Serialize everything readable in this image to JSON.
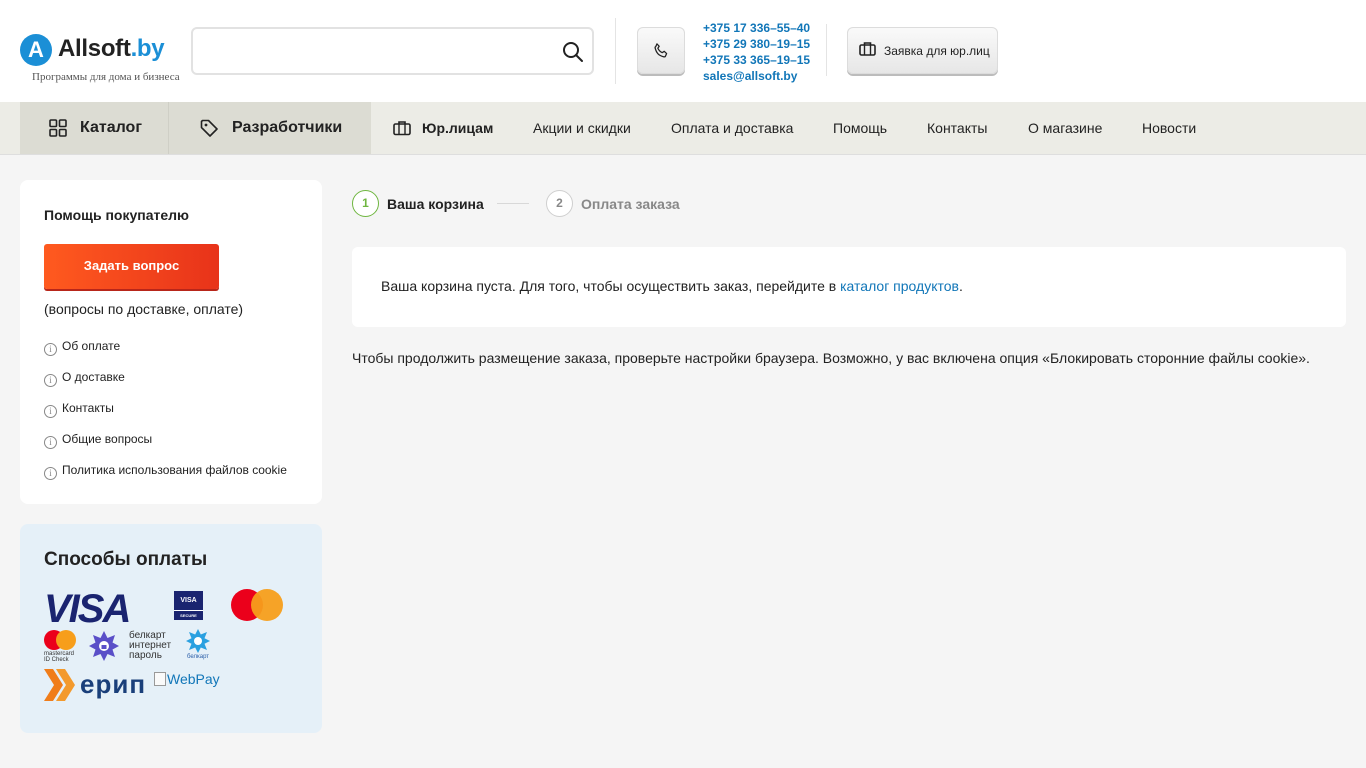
{
  "header": {
    "logo_letter": "A",
    "logo_name": "Allsoft",
    "logo_domain": ".by",
    "tagline": "Программы для дома и бизнеса",
    "search": {
      "value": "",
      "placeholder": ""
    },
    "phones": [
      "+375 17 336–55–40",
      "+375 29 380–19–15",
      "+375 33 365–19–15"
    ],
    "email": "sales@allsoft.by",
    "corp_request_label": "Заявка для юр.лиц"
  },
  "nav": {
    "catalog": "Каталог",
    "developers": "Разработчики",
    "legal": "Юр.лицам",
    "promotions": "Акции и скидки",
    "payment_delivery": "Оплата и доставка",
    "help": "Помощь",
    "contacts": "Контакты",
    "about": "О магазине",
    "news": "Новости"
  },
  "sidebar": {
    "help_title": "Помощь покупателю",
    "ask_button": "Задать вопрос",
    "ask_note": "(вопросы по доставке, оплате)",
    "links": [
      "Об оплате",
      "О доставке",
      "Контакты",
      "Общие вопросы",
      "Политика использования файлов cookie"
    ],
    "payments_title": "Способы оплаты",
    "payment_logos": {
      "visa": "VISA",
      "visa_secure": "VISA",
      "visa_secure_sub": "SECURE",
      "mc_idcheck": "mastercard ID Check",
      "belkart_ip": "белкарт интернет пароль",
      "belkart": "белкарт",
      "erip": "ерип",
      "webpay": "WebPay"
    },
    "colors": {
      "mc_red": "#eb001b",
      "mc_orange": "#f79e1b",
      "visa_blue": "#1a2470",
      "accent_orange": "#f04a1e"
    }
  },
  "checkout": {
    "steps": [
      {
        "number": "1",
        "label": "Ваша корзина",
        "active": true
      },
      {
        "number": "2",
        "label": "Оплата заказа",
        "active": false
      }
    ],
    "empty_message": "Ваша корзина пуста. Для того, чтобы осуществить заказ, перейдите в ",
    "catalog_link": "каталог продуктов",
    "empty_message_end": ".",
    "cookie_note": "Чтобы продолжить размещение заказа, проверьте настройки браузера. Возможно, у вас включена опция «Блокировать сторонние файлы cookie»."
  }
}
